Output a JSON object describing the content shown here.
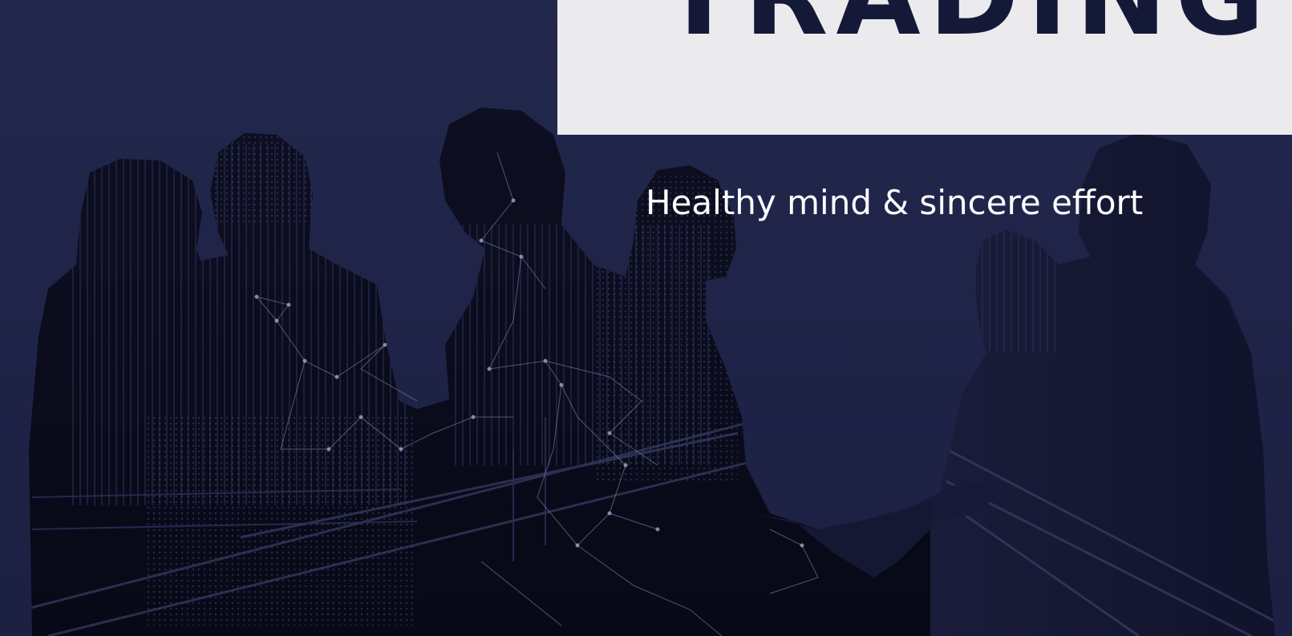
{
  "hero": {
    "title": "TRADING",
    "subtitle": "Healthy mind & sincere effort",
    "image_description_icon": "business-handshake-silhouette-image"
  },
  "colors": {
    "background": "#21264a",
    "silhouette": "#0c0d1c",
    "network_lines": "#8a90b8",
    "title_panel": "#ebebee",
    "title_text": "#141938",
    "subtitle_text": "#ffffff"
  }
}
